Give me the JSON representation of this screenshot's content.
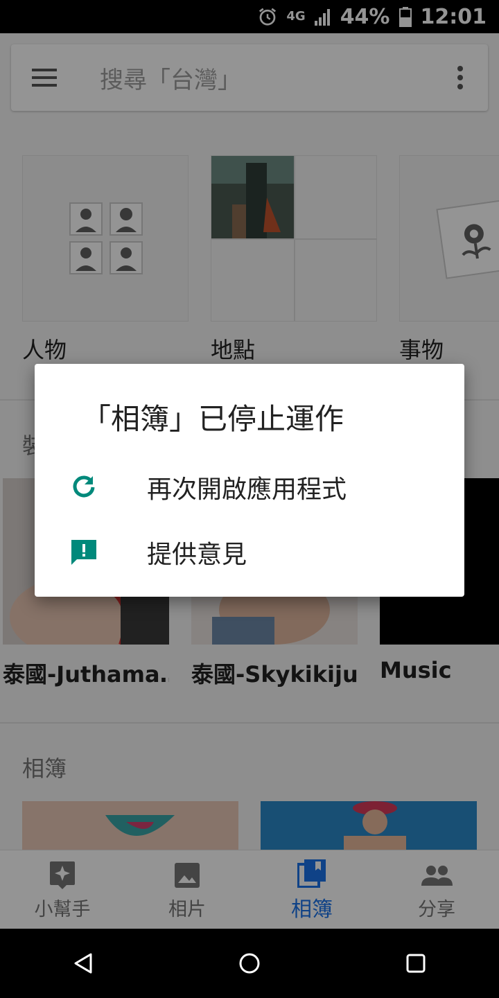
{
  "status_bar": {
    "network": "4G",
    "battery": "44%",
    "time": "12:01"
  },
  "search": {
    "placeholder": "搜尋「台灣」"
  },
  "categories": [
    {
      "label": "人物"
    },
    {
      "label": "地點"
    },
    {
      "label": "事物"
    }
  ],
  "sections": {
    "partial_heading": "裝",
    "albums_heading": "相簿"
  },
  "albums": [
    {
      "label": "泰國-Juthama…"
    },
    {
      "label": "泰國-Skykikiju…"
    },
    {
      "label": "Music"
    }
  ],
  "bottom_nav": [
    {
      "label": "小幫手",
      "icon": "assistant-icon"
    },
    {
      "label": "相片",
      "icon": "photo-icon"
    },
    {
      "label": "相簿",
      "icon": "albums-icon",
      "active": true
    },
    {
      "label": "分享",
      "icon": "people-icon"
    }
  ],
  "dialog": {
    "title": "「相簿」已停止運作",
    "actions": [
      {
        "label": "再次開啟應用程式",
        "icon": "refresh-icon"
      },
      {
        "label": "提供意見",
        "icon": "feedback-icon"
      }
    ]
  },
  "colors": {
    "accent": "#00897b",
    "active_nav": "#1a73e8"
  }
}
